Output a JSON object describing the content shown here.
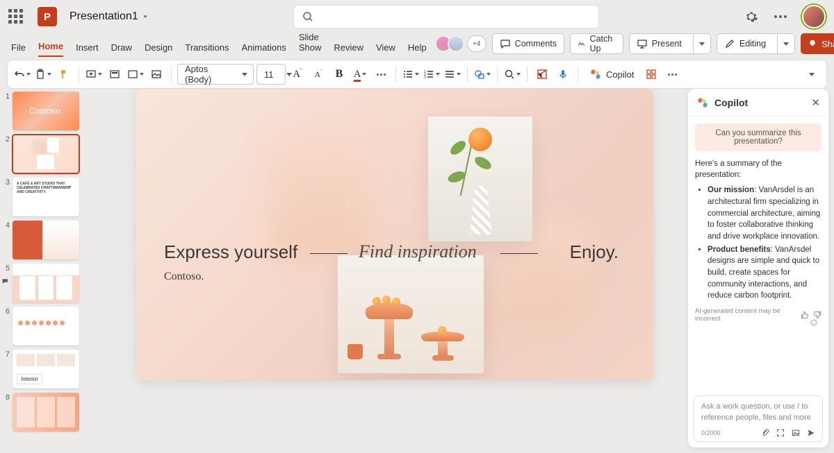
{
  "doc_title": "Presentation1",
  "tabs": [
    "File",
    "Home",
    "Insert",
    "Draw",
    "Design",
    "Transitions",
    "Animations",
    "Slide Show",
    "Review",
    "View",
    "Help"
  ],
  "active_tab": 1,
  "presence_more": "+4",
  "actions": {
    "comments": "Comments",
    "catchup": "Catch Up",
    "present": "Present",
    "editing": "Editing",
    "share": "Share"
  },
  "ribbon": {
    "font_name": "Aptos (Body)",
    "font_size": "11",
    "copilot": "Copilot"
  },
  "thumb_labels": {
    "t1": "Contoso.",
    "t3_line1": "A CAFÉ & ART STUDIO THAT",
    "t3_line2": "CELEBRATES CRAFTSMANSHIP",
    "t3_line3": "AND CREATIVITY.",
    "t7": "Interior"
  },
  "slide": {
    "express": "Express yourself",
    "find": "Find inspiration",
    "enjoy": "Enjoy.",
    "brand": "Contoso."
  },
  "copilot": {
    "title": "Copilot",
    "suggestion": "Can you summarize this presentation?",
    "intro": "Here's a summary of the presentation:",
    "bullet1_bold": "Our mission",
    "bullet1_rest": ": VanArsdel is an architectural firm specializing in commercial architecture, aiming to foster collaborative thinking and drive workplace innovation.",
    "bullet2_bold": "Product benefits",
    "bullet2_rest": ": VanArsdel designs are simple and quick to build, create spaces for community interactions, and reduce carbon footprint.",
    "disclaimer": "AI-generated content may be incorrect",
    "ask_placeholder": "Ask a work question, or use / to reference people, files and more",
    "counter": "0/2000"
  }
}
